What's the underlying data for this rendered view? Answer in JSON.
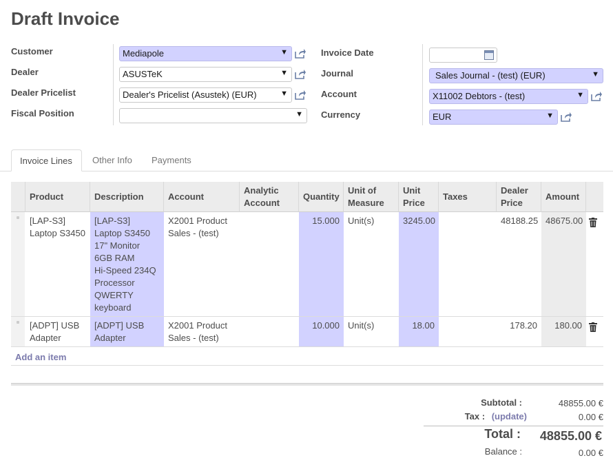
{
  "page": {
    "title": "Draft Invoice"
  },
  "form": {
    "customer": {
      "label": "Customer",
      "value": "Mediapole"
    },
    "dealer": {
      "label": "Dealer",
      "value": "ASUSTeK"
    },
    "dealer_pricelist": {
      "label": "Dealer Pricelist",
      "value": "Dealer's Pricelist (Asustek) (EUR)"
    },
    "fiscal_position": {
      "label": "Fiscal Position",
      "value": ""
    },
    "invoice_date": {
      "label": "Invoice Date",
      "value": ""
    },
    "journal": {
      "label": "Journal",
      "value": "Sales Journal - (test) (EUR)"
    },
    "account": {
      "label": "Account",
      "value": "X11002 Debtors - (test)"
    },
    "currency": {
      "label": "Currency",
      "value": "EUR"
    }
  },
  "tabs": [
    {
      "label": "Invoice Lines",
      "active": true
    },
    {
      "label": "Other Info",
      "active": false
    },
    {
      "label": "Payments",
      "active": false
    }
  ],
  "grid": {
    "columns": {
      "product": "Product",
      "description": "Description",
      "account": "Account",
      "analytic_l1": "Analytic",
      "analytic_l2": "Account",
      "quantity": "Quantity",
      "uom_l1": "Unit of",
      "uom_l2": "Measure",
      "unit_price_l1": "Unit",
      "unit_price_l2": "Price",
      "taxes": "Taxes",
      "dealer_price_l1": "Dealer",
      "dealer_price_l2": "Price",
      "amount": "Amount"
    },
    "rows": [
      {
        "product": [
          "[LAP-S3]",
          "Laptop S3450"
        ],
        "description": [
          "[LAP-S3]",
          "Laptop S3450",
          "17\" Monitor",
          "6GB RAM",
          "Hi-Speed 234Q",
          "Processor",
          "QWERTY",
          "keyboard"
        ],
        "account": [
          "X2001 Product",
          "Sales - (test)"
        ],
        "analytic": "",
        "quantity": "15.000",
        "uom": "Unit(s)",
        "unit_price": "3245.00",
        "taxes": "",
        "dealer_price": "48188.25",
        "amount": "48675.00"
      },
      {
        "product": [
          "[ADPT] USB",
          "Adapter"
        ],
        "description": [
          "[ADPT] USB",
          "Adapter"
        ],
        "account": [
          "X2001 Product",
          "Sales - (test)"
        ],
        "analytic": "",
        "quantity": "10.000",
        "uom": "Unit(s)",
        "unit_price": "18.00",
        "taxes": "",
        "dealer_price": "178.20",
        "amount": "180.00"
      }
    ],
    "add_item": "Add an item"
  },
  "totals": {
    "subtotal_label": "Subtotal :",
    "subtotal_value": "48855.00 €",
    "tax_label": "Tax :",
    "tax_update": "(update)",
    "tax_value": "0.00 €",
    "total_label": "Total :",
    "total_value": "48855.00 €",
    "balance_label": "Balance :",
    "balance_value": "0.00 €"
  },
  "colors": {
    "required_field": "#d2d2ff",
    "link": "#7c7bad",
    "header_bg": "#ececec"
  },
  "icons": {
    "external_link": "external-link-icon",
    "calendar": "calendar-icon",
    "trash": "trash-icon",
    "dropdown": "chevron-down-icon"
  }
}
